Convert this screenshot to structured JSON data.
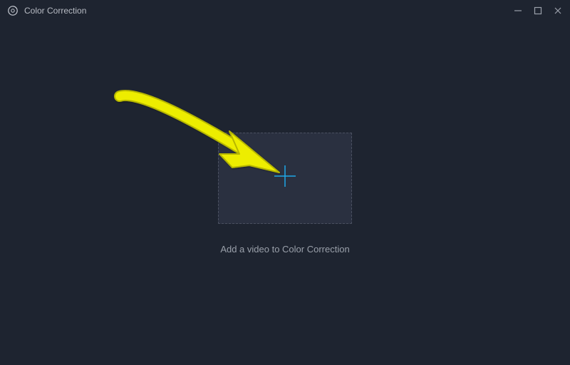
{
  "window": {
    "title": "Color Correction"
  },
  "main": {
    "prompt": "Add a video to Color Correction"
  },
  "colors": {
    "accent": "#1ea7e8",
    "arrow": "#eded00"
  }
}
